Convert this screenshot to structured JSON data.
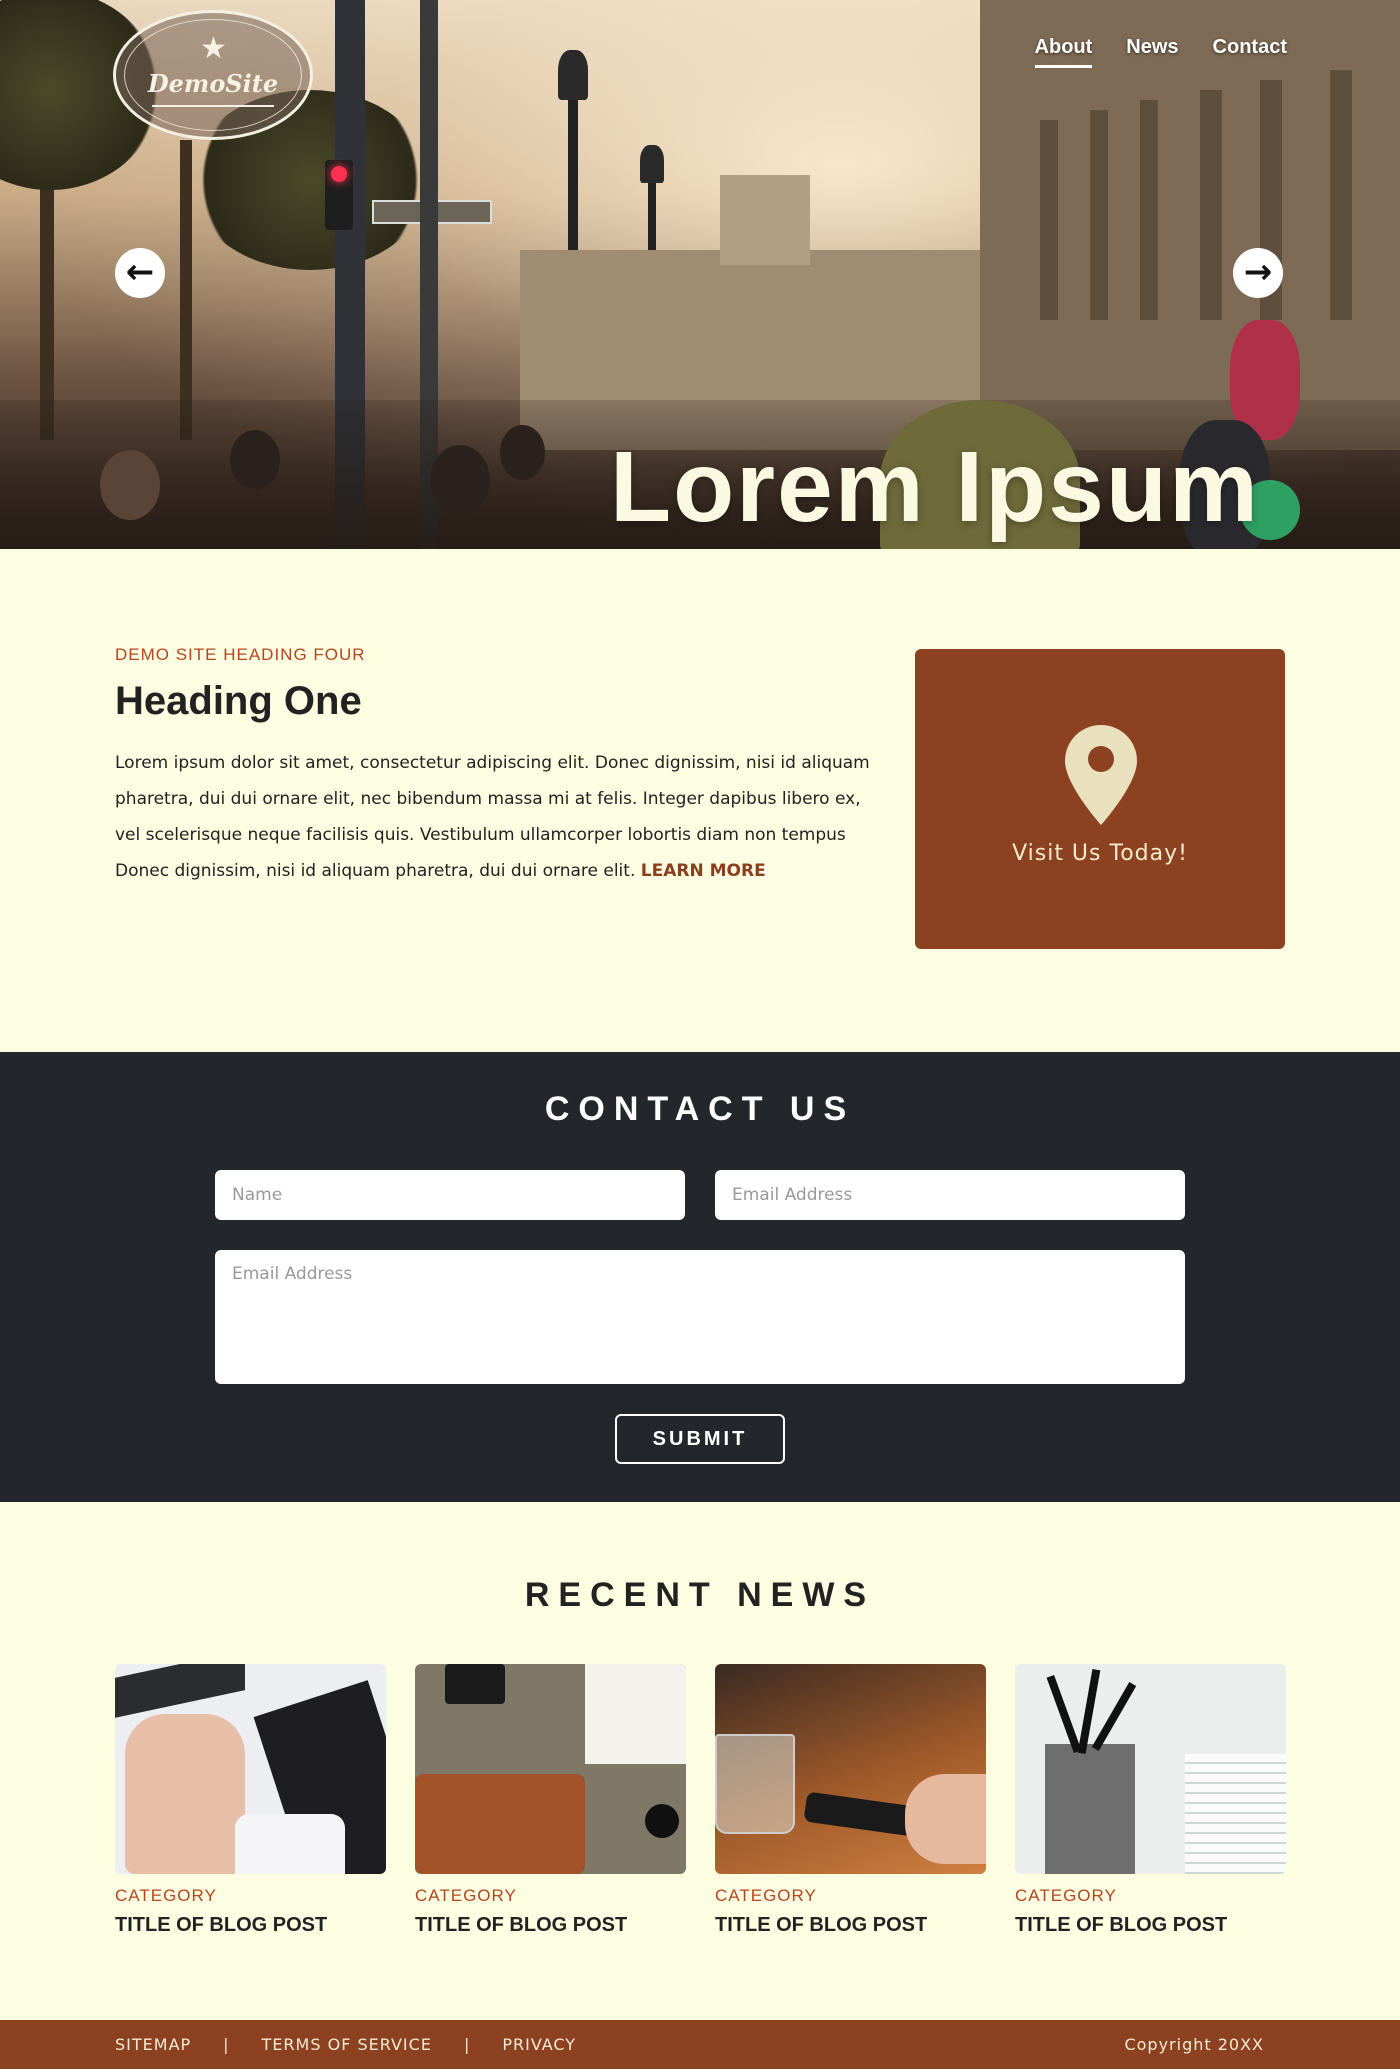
{
  "hero": {
    "title": "Lorem Ipsum",
    "logo_text": "DemoSite",
    "nav": [
      {
        "label": "About",
        "active": true
      },
      {
        "label": "News",
        "active": false
      },
      {
        "label": "Contact",
        "active": false
      }
    ],
    "prev_arrow": "←",
    "next_arrow": "→"
  },
  "intro": {
    "eyebrow": "DEMO SITE HEADING FOUR",
    "heading": "Heading One",
    "body": "Lorem ipsum dolor sit amet, consectetur adipiscing elit. Donec dignissim, nisi id aliquam pharetra, dui dui ornare elit, nec bibendum massa mi at felis. Integer dapibus libero ex, vel scelerisque neque facilisis quis. Vestibulum ullamcorper lobortis diam non tempus Donec dignissim, nisi id aliquam pharetra, dui dui ornare elit.",
    "learn_more": "LEARN MORE",
    "visit_card": {
      "icon": "map-pin-icon",
      "text": "Visit Us Today!"
    }
  },
  "contact": {
    "heading": "CONTACT US",
    "name_placeholder": "Name",
    "email_placeholder": "Email Address",
    "message_placeholder": "Email Address",
    "submit_label": "SUBMIT"
  },
  "news": {
    "heading": "RECENT NEWS",
    "posts": [
      {
        "category": "CATEGORY",
        "title": "TITLE OF BLOG POST"
      },
      {
        "category": "CATEGORY",
        "title": "TITLE OF BLOG POST"
      },
      {
        "category": "CATEGORY",
        "title": "TITLE OF BLOG POST"
      },
      {
        "category": "CATEGORY",
        "title": "TITLE OF BLOG POST"
      }
    ]
  },
  "footer": {
    "links": [
      "SITEMAP",
      "TERMS OF SERVICE",
      "PRIVACY"
    ],
    "separator": "|",
    "copyright": "Copyright 20XX"
  },
  "colors": {
    "background": "#fdfde2",
    "accent": "#8c4220",
    "eyebrow": "#b4461f",
    "dark": "#23262a"
  }
}
